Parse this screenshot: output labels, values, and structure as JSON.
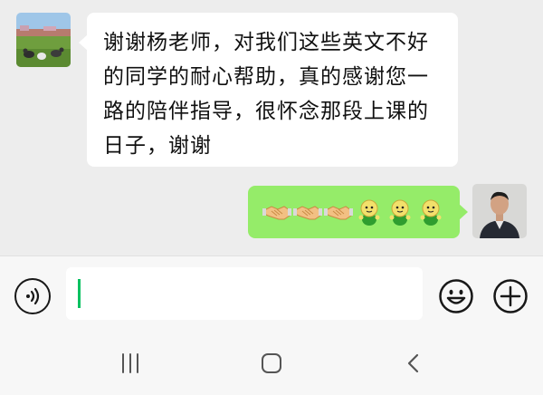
{
  "chat": {
    "messages": [
      {
        "side": "left",
        "lines": [
          "谢谢杨老师，对我们这些英文不好",
          "的同学的耐心帮助，真的感谢您一",
          "路的陪伴指导，很怀念那段上课的",
          "日子，谢谢"
        ]
      },
      {
        "side": "right",
        "emojis": [
          "handshake",
          "handshake",
          "handshake",
          "green-doll",
          "green-doll",
          "green-doll"
        ]
      }
    ]
  },
  "input": {
    "value": ""
  },
  "icons": {
    "voice": "voice-icon",
    "emoji": "emoji-icon",
    "plus": "plus-icon",
    "nav_recent": "recent-apps-icon",
    "nav_home": "home-icon",
    "nav_back": "back-icon"
  },
  "colors": {
    "background": "#ededed",
    "bubble_in": "#ffffff",
    "bubble_out": "#95ec69",
    "cursor": "#07c160"
  }
}
